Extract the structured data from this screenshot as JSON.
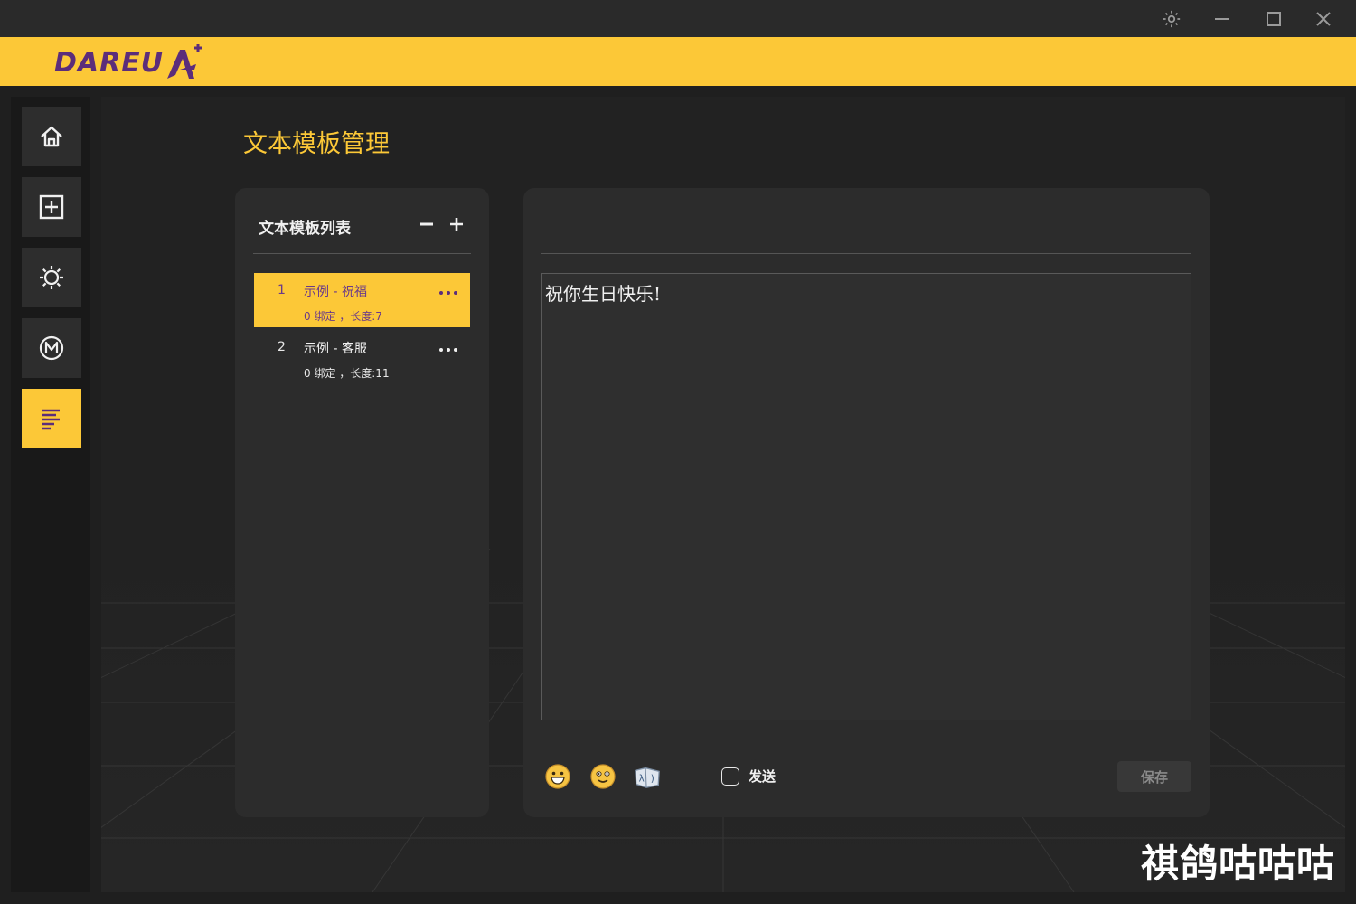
{
  "window": {
    "controls": [
      {
        "name": "settings-icon",
        "label": "settings"
      },
      {
        "name": "minimize-icon",
        "label": "minimize"
      },
      {
        "name": "maximize-icon",
        "label": "maximize"
      },
      {
        "name": "close-icon",
        "label": "close"
      }
    ]
  },
  "brand": {
    "logo_text": "DAREU",
    "accent": "#fcc837",
    "logo_color": "#5c2d7a"
  },
  "sidebar": {
    "items": [
      {
        "name": "home",
        "icon": "home-icon",
        "active": false
      },
      {
        "name": "add",
        "icon": "plus-square-icon",
        "active": false
      },
      {
        "name": "lighting",
        "icon": "sun-icon",
        "active": false
      },
      {
        "name": "macro",
        "icon": "m-circle-icon",
        "active": false
      },
      {
        "name": "text-template",
        "icon": "text-lines-icon",
        "active": true
      }
    ]
  },
  "page": {
    "title": "文本模板管理"
  },
  "template_list": {
    "header": "文本模板列表",
    "remove_label": "−",
    "add_label": "+",
    "items": [
      {
        "num": "1",
        "name": "示例 - 祝福",
        "meta": "0 绑定 ，长度:7",
        "active": true
      },
      {
        "num": "2",
        "name": "示例 - 客服",
        "meta": "0 绑定 ，长度:11",
        "active": false
      }
    ]
  },
  "editor": {
    "content": "祝你生日快乐!",
    "emoji_buttons": [
      "grin-emoji-icon",
      "smile-emoji-icon",
      "kaomoji-icon"
    ],
    "send_label": "发送",
    "send_checked": false,
    "save_label": "保存"
  },
  "watermark": "祺鸽咕咕咕"
}
